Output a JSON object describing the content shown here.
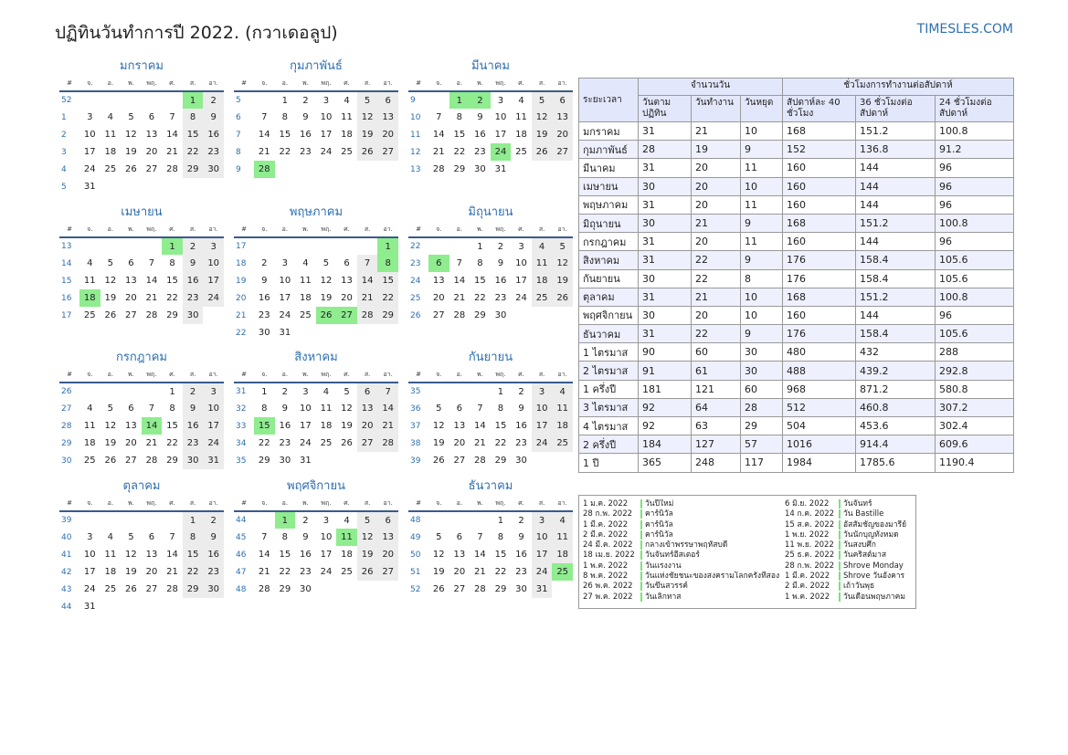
{
  "header": {
    "title": "ปฏิทินวันทำการปี 2022. (กวาเดอลูป)",
    "site": "TIMESLES.COM"
  },
  "calendar": {
    "weekday_headers": [
      "#",
      "จ.",
      "อ.",
      "พ.",
      "พฤ.",
      "ศ.",
      "ส.",
      "อา."
    ],
    "months": [
      {
        "name": "มกราคม",
        "first_week": 52,
        "lead": 5,
        "days": 31,
        "holidays": [
          1
        ]
      },
      {
        "name": "กุมภาพันธ์",
        "first_week": 5,
        "lead": 1,
        "days": 28,
        "holidays": [
          28
        ]
      },
      {
        "name": "มีนาคม",
        "first_week": 9,
        "lead": 1,
        "days": 31,
        "holidays": [
          1,
          2,
          24
        ]
      },
      {
        "name": "เมษายน",
        "first_week": 13,
        "lead": 4,
        "days": 30,
        "holidays": [
          1,
          18
        ]
      },
      {
        "name": "พฤษภาคม",
        "first_week": 17,
        "lead": 6,
        "days": 31,
        "holidays": [
          1,
          8,
          26,
          27
        ]
      },
      {
        "name": "มิถุนายน",
        "first_week": 22,
        "lead": 2,
        "days": 30,
        "holidays": [
          6
        ]
      },
      {
        "name": "กรกฎาคม",
        "first_week": 26,
        "lead": 4,
        "days": 31,
        "holidays": [
          14
        ]
      },
      {
        "name": "สิงหาคม",
        "first_week": 31,
        "lead": 0,
        "days": 31,
        "holidays": [
          15
        ]
      },
      {
        "name": "กันยายน",
        "first_week": 35,
        "lead": 3,
        "days": 30,
        "holidays": []
      },
      {
        "name": "ตุลาคม",
        "first_week": 39,
        "lead": 5,
        "days": 31,
        "holidays": []
      },
      {
        "name": "พฤศจิกายน",
        "first_week": 44,
        "lead": 1,
        "days": 30,
        "holidays": [
          1,
          11
        ]
      },
      {
        "name": "ธันวาคม",
        "first_week": 48,
        "lead": 3,
        "days": 31,
        "holidays": [
          25
        ]
      }
    ]
  },
  "stats": {
    "header_period": "ระยะเวลา",
    "group_days": "จำนวนวัน",
    "group_hours": "ชั่วโมงการทำงานต่อสัปดาห์",
    "sub_headers": [
      "วันตามปฏิทิน",
      "วันทำงาน",
      "วันหยุด",
      "สัปดาห์ละ 40 ชั่วโมง",
      "36 ชั่วโมงต่อสัปดาห์",
      "24 ชั่วโมงต่อสัปดาห์"
    ],
    "rows": [
      [
        "มกราคม",
        "31",
        "21",
        "10",
        "168",
        "151.2",
        "100.8"
      ],
      [
        "กุมภาพันธ์",
        "28",
        "19",
        "9",
        "152",
        "136.8",
        "91.2"
      ],
      [
        "มีนาคม",
        "31",
        "20",
        "11",
        "160",
        "144",
        "96"
      ],
      [
        "เมษายน",
        "30",
        "20",
        "10",
        "160",
        "144",
        "96"
      ],
      [
        "พฤษภาคม",
        "31",
        "20",
        "11",
        "160",
        "144",
        "96"
      ],
      [
        "มิถุนายน",
        "30",
        "21",
        "9",
        "168",
        "151.2",
        "100.8"
      ],
      [
        "กรกฎาคม",
        "31",
        "20",
        "11",
        "160",
        "144",
        "96"
      ],
      [
        "สิงหาคม",
        "31",
        "22",
        "9",
        "176",
        "158.4",
        "105.6"
      ],
      [
        "กันยายน",
        "30",
        "22",
        "8",
        "176",
        "158.4",
        "105.6"
      ],
      [
        "ตุลาคม",
        "31",
        "21",
        "10",
        "168",
        "151.2",
        "100.8"
      ],
      [
        "พฤศจิกายน",
        "30",
        "20",
        "10",
        "160",
        "144",
        "96"
      ],
      [
        "ธันวาคม",
        "31",
        "22",
        "9",
        "176",
        "158.4",
        "105.6"
      ],
      [
        "1 ไตรมาส",
        "90",
        "60",
        "30",
        "480",
        "432",
        "288"
      ],
      [
        "2 ไตรมาส",
        "91",
        "61",
        "30",
        "488",
        "439.2",
        "292.8"
      ],
      [
        "1 ครึ่งปี",
        "181",
        "121",
        "60",
        "968",
        "871.2",
        "580.8"
      ],
      [
        "3 ไตรมาส",
        "92",
        "64",
        "28",
        "512",
        "460.8",
        "307.2"
      ],
      [
        "4 ไตรมาส",
        "92",
        "63",
        "29",
        "504",
        "453.6",
        "302.4"
      ],
      [
        "2 ครึ่งปี",
        "184",
        "127",
        "57",
        "1016",
        "914.4",
        "609.6"
      ],
      [
        "1 ปี",
        "365",
        "248",
        "117",
        "1984",
        "1785.6",
        "1190.4"
      ]
    ]
  },
  "holidays": {
    "left": [
      [
        "1 ม.ค. 2022",
        "วันปีใหม่"
      ],
      [
        "28 ก.พ. 2022",
        "คาร์นิวัล"
      ],
      [
        "1 มี.ค. 2022",
        "คาร์นิวัล"
      ],
      [
        "2 มี.ค. 2022",
        "คาร์นิวัล"
      ],
      [
        "24 มี.ค. 2022",
        "กลางเข้าพรรษาพฤหัสบดี"
      ],
      [
        "18 เม.ย. 2022",
        "วันจันทร์อีสเตอร์"
      ],
      [
        "1 พ.ค. 2022",
        "วันแรงงาน"
      ],
      [
        "8 พ.ค. 2022",
        "วันแห่งชัยชนะของสงครามโลกครั้งที่สอง"
      ],
      [
        "26 พ.ค. 2022",
        "วันขึ้นสวรรค์"
      ],
      [
        "27 พ.ค. 2022",
        "วันเลิกทาส"
      ]
    ],
    "right": [
      [
        "6 มิ.ย. 2022",
        "วันจันทร์"
      ],
      [
        "14 ก.ค. 2022",
        "วัน Bastille"
      ],
      [
        "15 ส.ค. 2022",
        "อัสสัมชัญของมารีย์"
      ],
      [
        "1 พ.ย. 2022",
        "วันนักบุญทั้งหมด"
      ],
      [
        "11 พ.ย. 2022",
        "วันสงบศึก"
      ],
      [
        "25 ธ.ค. 2022",
        "วันคริสต์มาส"
      ],
      [
        "28 ก.พ. 2022",
        "Shrove Monday"
      ],
      [
        "1 มี.ค. 2022",
        "Shrove วันอังคาร"
      ],
      [
        "2 มี.ค. 2022",
        "เถ้าวันพุธ"
      ],
      [
        "1 พ.ค. 2022",
        "วันเดือนพฤษภาคม"
      ]
    ]
  }
}
